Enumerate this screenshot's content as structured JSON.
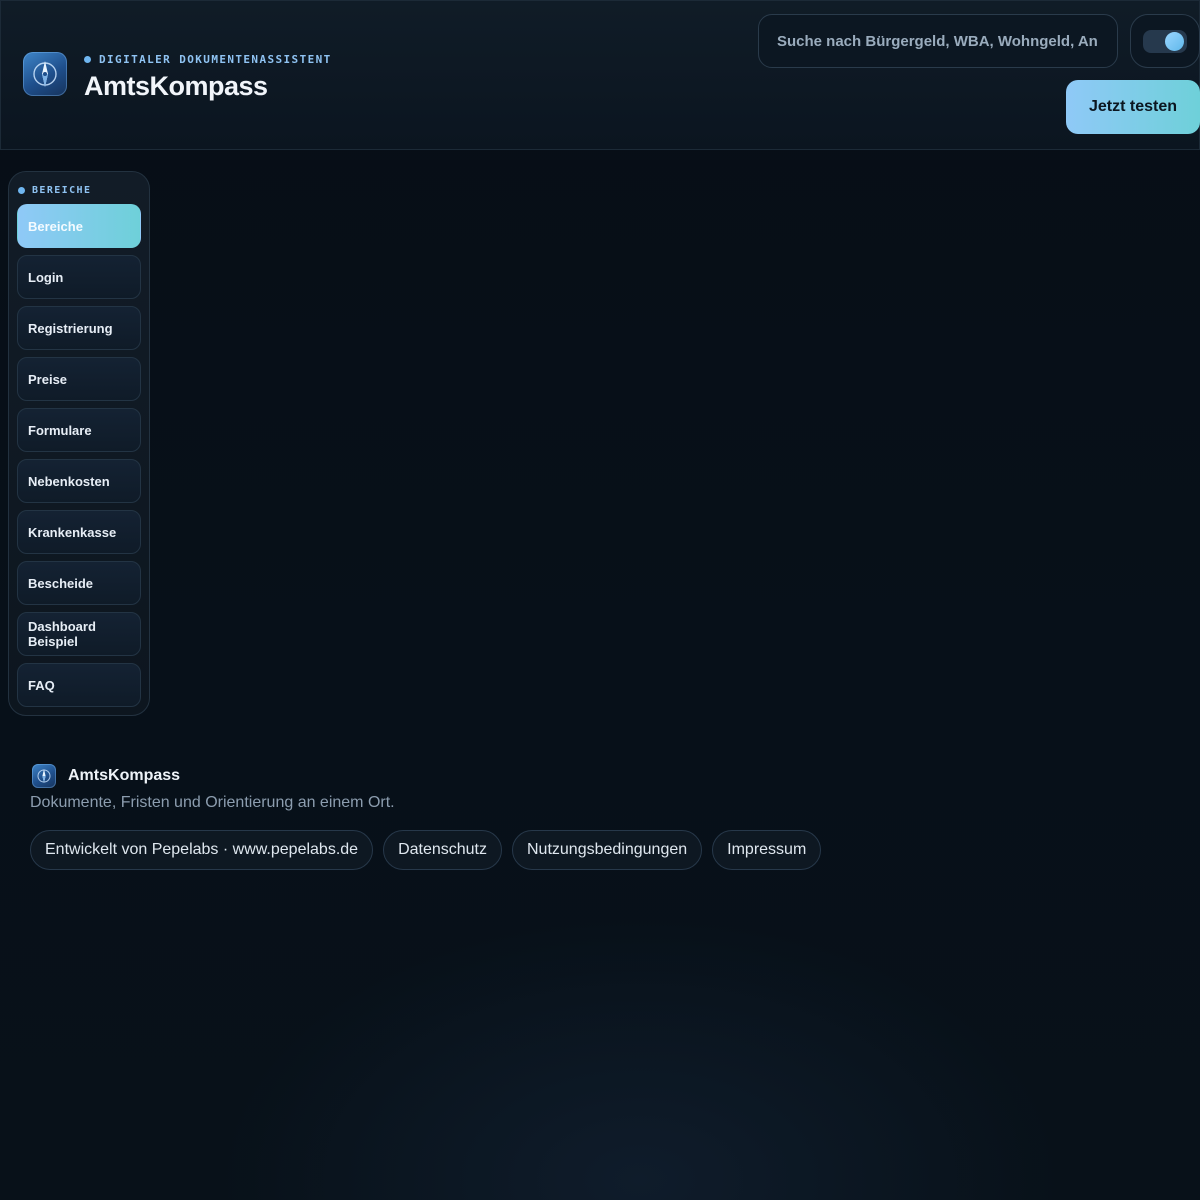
{
  "header": {
    "eyebrow": "DIGITALER DOKUMENTENASSISTENT",
    "title": "AmtsKompass",
    "search_placeholder": "Suche nach Bürgergeld, WBA, Wohngeld, An",
    "cta_label": "Jetzt testen",
    "theme_toggle_on": true
  },
  "sidebar": {
    "heading": "BEREICHE",
    "items": [
      {
        "label": "Bereiche",
        "active": true
      },
      {
        "label": "Login"
      },
      {
        "label": "Registrierung"
      },
      {
        "label": "Preise"
      },
      {
        "label": "Formulare"
      },
      {
        "label": "Nebenkosten"
      },
      {
        "label": "Krankenkasse"
      },
      {
        "label": "Bescheide"
      },
      {
        "label": "Dashboard Beispiel"
      },
      {
        "label": "FAQ"
      }
    ]
  },
  "footer": {
    "brand": "AmtsKompass",
    "tagline": "Dokumente, Fristen und Orientierung an einem Ort.",
    "links": [
      "Entwickelt von Pepelabs · www.pepelabs.de",
      "Datenschutz",
      "Nutzungsbedingungen",
      "Impressum"
    ]
  },
  "colors": {
    "accent_gradient_start": "#8fc9f7",
    "accent_gradient_end": "#6ed0d9",
    "background": "#070e16"
  },
  "icons": {
    "logo": "compass-icon"
  }
}
